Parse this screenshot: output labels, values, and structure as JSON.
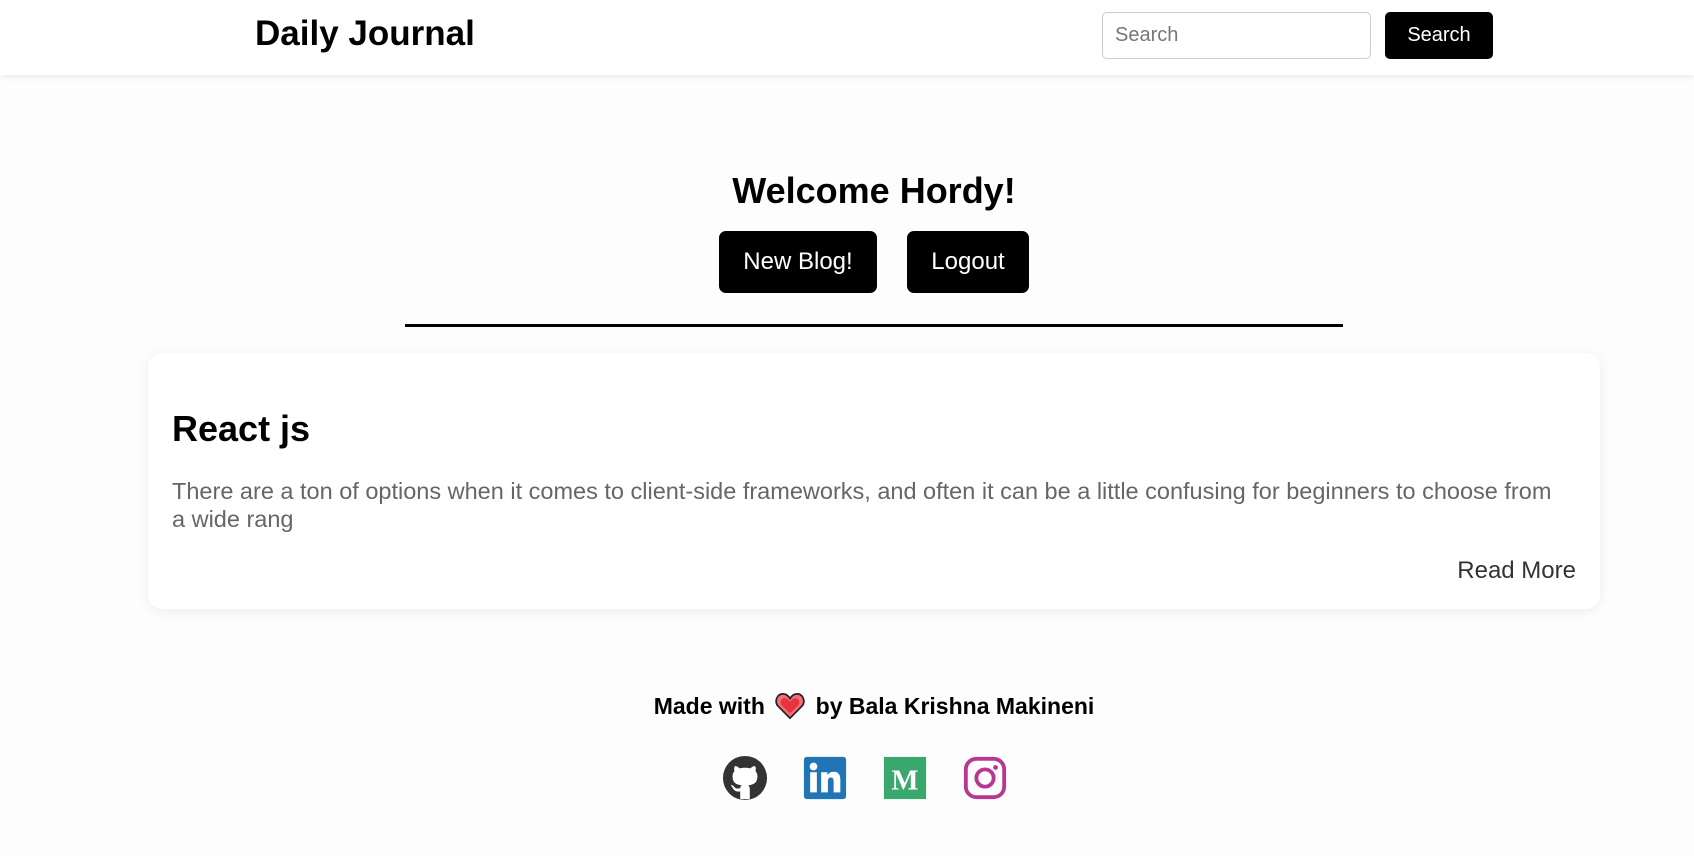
{
  "header": {
    "brand": "Daily Journal",
    "search_placeholder": "Search",
    "search_value": "",
    "search_button": "Search"
  },
  "main": {
    "welcome": "Welcome Hordy!",
    "new_blog_button": "New Blog!",
    "logout_button": "Logout"
  },
  "posts": [
    {
      "title": "React js",
      "excerpt": "There are a ton of options when it comes to client-side frameworks, and often it can be a little confusing for beginners to choose from a wide rang",
      "read_more": "Read More"
    }
  ],
  "footer": {
    "made_with": "Made with",
    "by": "by Bala Krishna Makineni",
    "heart_icon": "heart-icon",
    "socials": [
      {
        "name": "github-icon",
        "color": "#333333"
      },
      {
        "name": "linkedin-icon",
        "color": "#2275b4"
      },
      {
        "name": "medium-icon",
        "color": "#3aa76d"
      },
      {
        "name": "instagram-icon",
        "color": "#b83793"
      }
    ]
  }
}
